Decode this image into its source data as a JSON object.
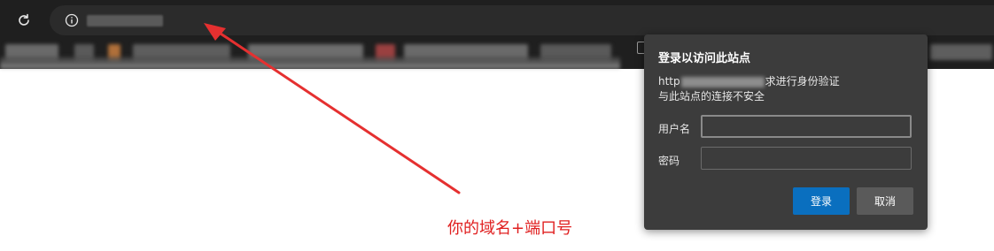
{
  "browser": {
    "reload_icon": "reload-icon",
    "info_icon": "info-icon"
  },
  "dialog": {
    "title": "登录以访问此站点",
    "line1_prefix": "http",
    "line1_suffix": "求进行身份验证",
    "line2": "与此站点的连接不安全",
    "username_label": "用户名",
    "username_value": "",
    "password_label": "密码",
    "password_value": "",
    "login_button": "登录",
    "cancel_button": "取消"
  },
  "annotation": {
    "text": "你的域名+端口号",
    "color": "#e02020"
  }
}
